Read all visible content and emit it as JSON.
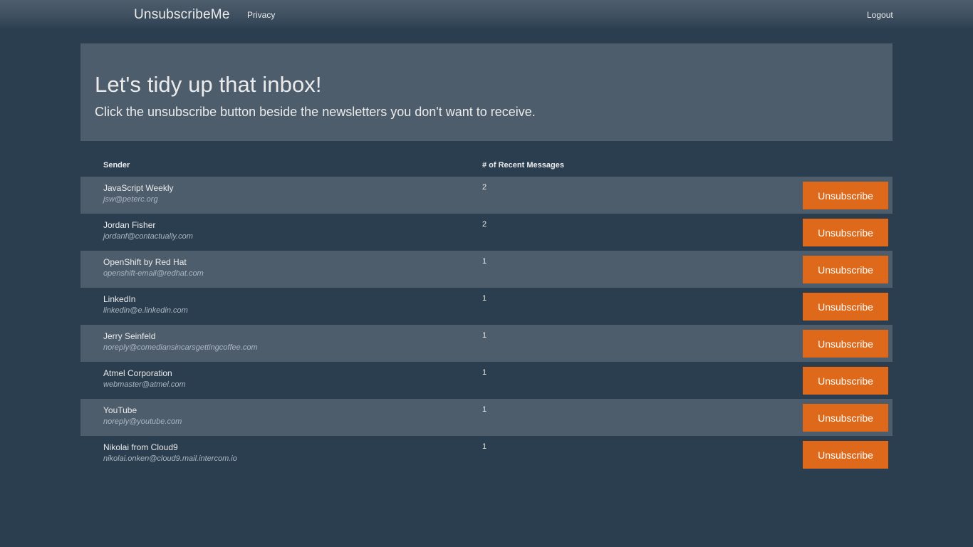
{
  "navbar": {
    "brand": "UnsubscribeMe",
    "privacy_label": "Privacy",
    "logout_label": "Logout"
  },
  "hero": {
    "title": "Let's tidy up that inbox!",
    "subtitle": "Click the unsubscribe button beside the newsletters you don't want to receive."
  },
  "table": {
    "headers": {
      "sender": "Sender",
      "count": "# of Recent Messages"
    },
    "button_label": "Unsubscribe",
    "rows": [
      {
        "name": "JavaScript Weekly",
        "email": "jsw@peterc.org",
        "count": "2"
      },
      {
        "name": "Jordan Fisher",
        "email": "jordanf@contactually.com",
        "count": "2"
      },
      {
        "name": "OpenShift by Red Hat",
        "email": "openshift-email@redhat.com",
        "count": "1"
      },
      {
        "name": "LinkedIn",
        "email": "linkedin@e.linkedin.com",
        "count": "1"
      },
      {
        "name": "Jerry Seinfeld",
        "email": "noreply@comediansincarsgettingcoffee.com",
        "count": "1"
      },
      {
        "name": "Atmel Corporation",
        "email": "webmaster@atmel.com",
        "count": "1"
      },
      {
        "name": "YouTube",
        "email": "noreply@youtube.com",
        "count": "1"
      },
      {
        "name": "Nikolai from Cloud9",
        "email": "nikolai.onken@cloud9.mail.intercom.io",
        "count": "1"
      }
    ]
  },
  "colors": {
    "background": "#2b3e50",
    "panel": "#4e5d6c",
    "accent": "#df691a",
    "text": "#ebebeb",
    "muted": "#abb6c2"
  }
}
